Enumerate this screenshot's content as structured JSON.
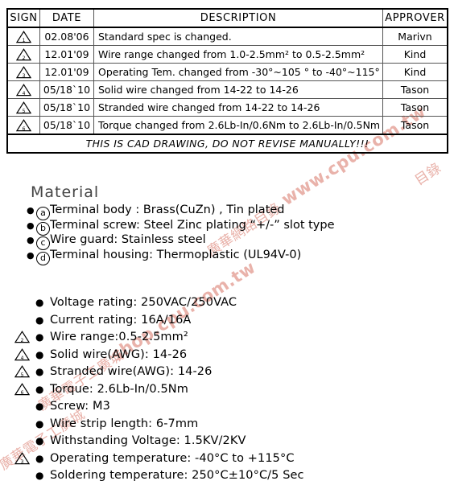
{
  "revision_table": {
    "headers": [
      "SIGN",
      "DATE",
      "DESCRIPTION",
      "APPROVER"
    ],
    "rows": [
      {
        "sign": "1",
        "date": "02.08'06",
        "description": "Standard spec is changed.",
        "approver": "Marivn"
      },
      {
        "sign": "2",
        "date": "12.01'09",
        "description": "Wire range changed from 1.0-2.5mm² to 0.5-2.5mm²",
        "approver": "Kind"
      },
      {
        "sign": "3",
        "date": "12.01'09",
        "description": "Operating Tem. changed from -30°~105 ° to -40°~115°",
        "approver": "Kind"
      },
      {
        "sign": "4",
        "date": "05/18`10",
        "description": "Solid wire changed from 14-22 to 14-26",
        "approver": "Tason"
      },
      {
        "sign": "5",
        "date": "05/18`10",
        "description": "Stranded wire changed from 14-22 to 14-26",
        "approver": "Tason"
      },
      {
        "sign": "6",
        "date": "05/18`10",
        "description": "Torque changed from 2.6Lb-In/0.6Nm to 2.6Lb-In/0.5Nm",
        "approver": "Tason"
      }
    ],
    "note": "THIS IS CAD DRAWING, DO NOT REVISE MANUALLY!!!"
  },
  "material": {
    "title": "Material",
    "items": [
      {
        "marker": "a",
        "text": "Terminal body : Brass(CuZn) , Tin plated"
      },
      {
        "marker": "b",
        "text": "Terminal screw: Steel Zinc plating “+/-” slot type"
      },
      {
        "marker": "c",
        "text": "Wire guard: Stainless steel"
      },
      {
        "marker": "d",
        "text": "Terminal housing: Thermoplastic (UL94V-0)"
      }
    ]
  },
  "specifications": [
    {
      "sign": "",
      "text": "Voltage rating: 250VAC/250VAC"
    },
    {
      "sign": "",
      "text": "Current rating: 16A/16A"
    },
    {
      "sign": "2",
      "text": "Wire range:0.5-2.5mm²"
    },
    {
      "sign": "4",
      "text": "Solid wire(AWG): 14-26"
    },
    {
      "sign": "5",
      "text": "Stranded wire(AWG): 14-26"
    },
    {
      "sign": "6",
      "text": "Torque: 2.6Lb-In/0.5Nm"
    },
    {
      "sign": "",
      "text": "Screw: M3"
    },
    {
      "sign": "",
      "text": "Wire strip length: 6-7mm"
    },
    {
      "sign": "",
      "text": "Withstanding Voltage: 1.5KV/2KV"
    },
    {
      "sign": "3",
      "text": "Operating temperature: -40°C to +115°C"
    },
    {
      "sign": "",
      "text": "Soldering temperature: 250°C±10°C/5 Sec"
    }
  ],
  "watermarks": {
    "top_right": "www.cpu.com.tw",
    "top_right_cjk": "廣華網路目錄",
    "mid_left": "shop.cpu.com.tw",
    "mid_left_cjk": "廣華電子工廣城",
    "bottom_left_cjk": "廣華電子工廣城",
    "far_right_cjk": "目錄",
    "color": "#e9b2aa"
  }
}
